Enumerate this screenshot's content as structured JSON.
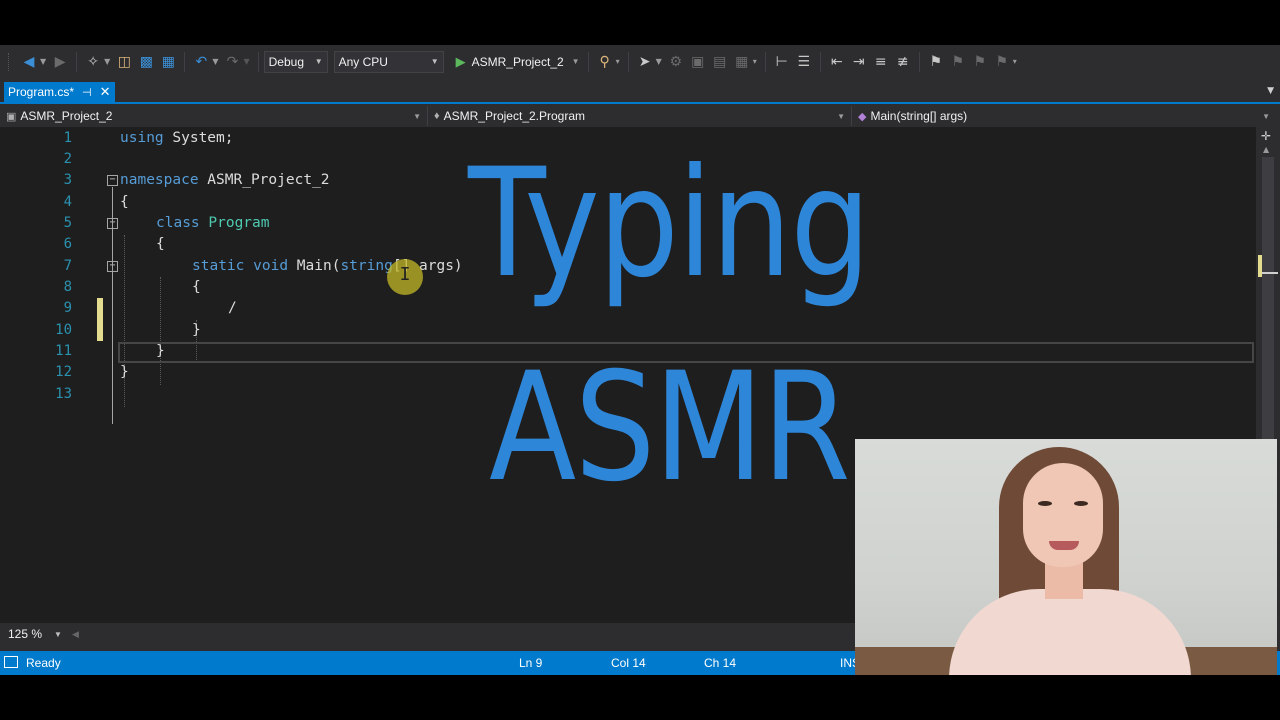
{
  "toolbar": {
    "config": "Debug",
    "platform": "Any CPU",
    "start_label": "ASMR_Project_2"
  },
  "tab": {
    "title": "Program.cs*"
  },
  "navbar": {
    "project": "ASMR_Project_2",
    "type": "ASMR_Project_2.Program",
    "member": "Main(string[] args)"
  },
  "editor": {
    "line_numbers": [
      "1",
      "2",
      "3",
      "4",
      "5",
      "6",
      "7",
      "8",
      "9",
      "10",
      "11",
      "12",
      "13"
    ],
    "lines": {
      "l1_kw": "using",
      "l1_rest": " System;",
      "l3_kw": "namespace",
      "l3_rest": " ASMR_Project_2",
      "l4": "{",
      "l5_kw": "class",
      "l5_cls": "Program",
      "l6": "{",
      "l7_kw1": "static",
      "l7_kw2": "void",
      "l7_name": " Main(",
      "l7_kw3": "string",
      "l7_rest": "[] args)",
      "l8": "{",
      "l9": "/",
      "l10": "}",
      "l11": "}",
      "l12": "}"
    }
  },
  "overlay": {
    "line1": "Typing",
    "line2": "ASMR"
  },
  "zoom": "125 %",
  "status": {
    "ready": "Ready",
    "ln": "Ln 9",
    "col": "Col 14",
    "ch": "Ch 14",
    "ins": "INS"
  },
  "colors": {
    "accent": "#007acc",
    "title_blue": "#2e86d9",
    "keyword": "#569cd6",
    "type": "#4ec9b0",
    "line_number": "#2b91af",
    "change_marker": "#e3dc8e"
  },
  "icons": [
    "back-icon",
    "forward-icon",
    "new-project-icon",
    "open-icon",
    "save-icon",
    "save-all-icon",
    "undo-icon",
    "redo-icon",
    "start-icon",
    "find-icon",
    "bookmark-icon",
    "pin-icon",
    "close-icon"
  ]
}
